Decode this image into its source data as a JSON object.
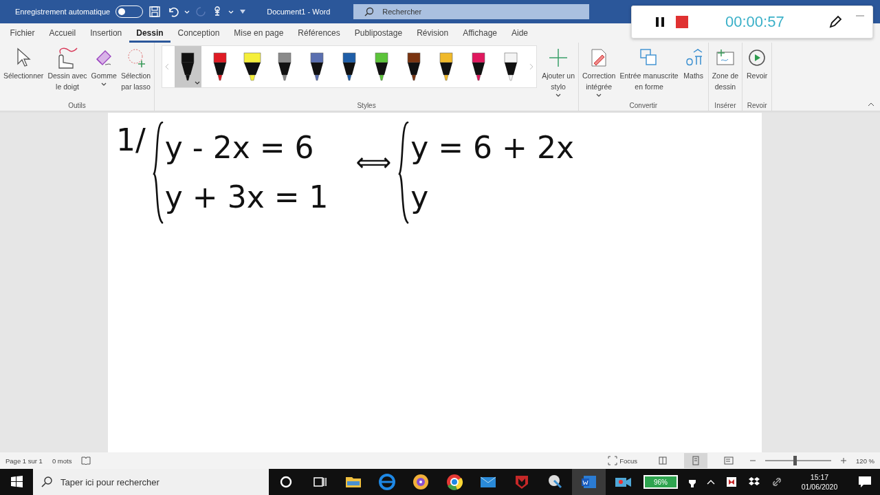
{
  "title_bar": {
    "autosave_label": "Enregistrement automatique",
    "autosave_on": false,
    "redo_disabled": true,
    "document_title": "Document1 - Word",
    "search_placeholder": "Rechercher"
  },
  "recorder": {
    "time": "00:00:57"
  },
  "tabs": [
    {
      "label": "Fichier",
      "selected": false
    },
    {
      "label": "Accueil",
      "selected": false
    },
    {
      "label": "Insertion",
      "selected": false
    },
    {
      "label": "Dessin",
      "selected": true
    },
    {
      "label": "Conception",
      "selected": false
    },
    {
      "label": "Mise en page",
      "selected": false
    },
    {
      "label": "Références",
      "selected": false
    },
    {
      "label": "Publipostage",
      "selected": false
    },
    {
      "label": "Révision",
      "selected": false
    },
    {
      "label": "Affichage",
      "selected": false
    },
    {
      "label": "Aide",
      "selected": false
    }
  ],
  "ribbon": {
    "tools": {
      "name": "Outils",
      "buttons": [
        {
          "label": "Sélectionner",
          "dropdown": false
        },
        {
          "label": "Dessin avec\nle doigt",
          "dropdown": false
        },
        {
          "label": "Gomme",
          "dropdown": true
        },
        {
          "label": "Sélection\npar lasso",
          "dropdown": false
        }
      ]
    },
    "styles": {
      "name": "Styles",
      "pens": [
        {
          "color": "#111111",
          "selected": true,
          "kind": "pen"
        },
        {
          "color": "#e01b24",
          "selected": false,
          "kind": "pen"
        },
        {
          "color": "#f5ef3a",
          "selected": false,
          "kind": "highlighter"
        },
        {
          "color": "#8a8a8a",
          "selected": false,
          "kind": "pen"
        },
        {
          "color": "#5a6fb0",
          "selected": false,
          "kind": "pen"
        },
        {
          "color": "#1f5ea8",
          "selected": false,
          "kind": "pen"
        },
        {
          "color": "#5cc43a",
          "selected": false,
          "kind": "pen"
        },
        {
          "color": "#7a3410",
          "selected": false,
          "kind": "pen"
        },
        {
          "color": "#f0b92a",
          "selected": false,
          "kind": "pen"
        },
        {
          "color": "#e0185e",
          "selected": false,
          "kind": "pen"
        },
        {
          "color": "#f4f4f4",
          "selected": false,
          "kind": "pen"
        }
      ],
      "add_pen": "Ajouter un\nstylo"
    },
    "convert": {
      "name": "Convertir",
      "buttons": [
        {
          "label": "Correction\nintégrée",
          "dropdown": true
        },
        {
          "label": "Entrée manuscrite\nen forme",
          "dropdown": false
        },
        {
          "label": "Maths",
          "dropdown": false
        }
      ]
    },
    "insert": {
      "name": "Insérer",
      "buttons": [
        {
          "label": "Zone de\ndessin",
          "dropdown": false
        }
      ]
    },
    "replay": {
      "name": "Revoir",
      "buttons": [
        {
          "label": "Revoir",
          "dropdown": false
        }
      ]
    }
  },
  "document": {
    "ink": {
      "number": "1/",
      "left_system": [
        "y - 2x = 6",
        "y + 3x = 1"
      ],
      "equivalence": "⟺",
      "right_system": [
        "y = 6 + 2x",
        "y"
      ]
    }
  },
  "status_bar": {
    "page": "Page 1 sur 1",
    "words": "0 mots",
    "focus": "Focus",
    "views": [
      {
        "selected": false
      },
      {
        "selected": true
      },
      {
        "selected": false
      }
    ],
    "zoom": {
      "level": 0.45,
      "reading": "120 %"
    }
  },
  "taskbar": {
    "search_placeholder": "Taper ici pour rechercher",
    "battery": "96%",
    "time": "15:17",
    "date": "01/06/2020"
  }
}
